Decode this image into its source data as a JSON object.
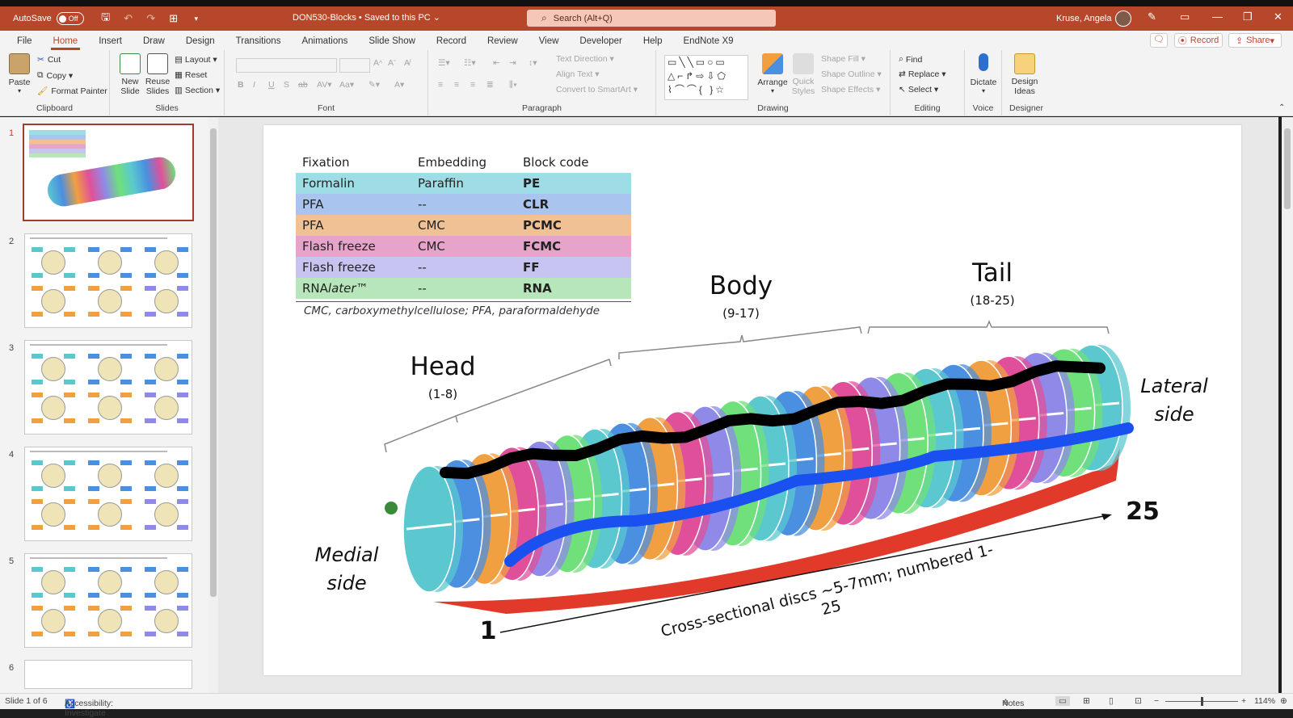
{
  "titlebar": {
    "autosave_label": "AutoSave",
    "autosave_state": "Off",
    "doc_title": "DON530-Blocks • Saved to this PC ⌄",
    "search_placeholder": "Search (Alt+Q)",
    "user_name": "Kruse, Angela"
  },
  "menu": {
    "tabs": [
      "File",
      "Home",
      "Insert",
      "Draw",
      "Design",
      "Transitions",
      "Animations",
      "Slide Show",
      "Record",
      "Review",
      "View",
      "Developer",
      "Help",
      "EndNote X9"
    ],
    "active": "Home",
    "record_label": "Record",
    "share_label": "Share"
  },
  "ribbon": {
    "clipboard": {
      "label": "Clipboard",
      "paste": "Paste",
      "cut": "Cut",
      "copy": "Copy",
      "format_painter": "Format Painter"
    },
    "slides": {
      "label": "Slides",
      "new_slide": "New Slide",
      "reuse_slides": "Reuse Slides",
      "layout": "Layout",
      "reset": "Reset",
      "section": "Section"
    },
    "font": {
      "label": "Font"
    },
    "paragraph": {
      "label": "Paragraph",
      "text_direction": "Text Direction",
      "align_text": "Align Text",
      "convert_smartart": "Convert to SmartArt"
    },
    "drawing": {
      "label": "Drawing",
      "arrange": "Arrange",
      "quick_styles": "Quick Styles",
      "shape_fill": "Shape Fill",
      "shape_outline": "Shape Outline",
      "shape_effects": "Shape Effects"
    },
    "editing": {
      "label": "Editing",
      "find": "Find",
      "replace": "Replace",
      "select": "Select"
    },
    "voice": {
      "label": "Voice",
      "dictate": "Dictate"
    },
    "designer": {
      "label": "Designer",
      "design_ideas": "Design Ideas"
    }
  },
  "thumbnails": [
    "1",
    "2",
    "3",
    "4",
    "5",
    "6"
  ],
  "slide": {
    "table": {
      "headers": [
        "Fixation",
        "Embedding",
        "Block code"
      ],
      "rows": [
        {
          "fixation": "Formalin",
          "embedding": "Paraffin",
          "code": "PE",
          "color": "#9fdde6"
        },
        {
          "fixation": "PFA",
          "embedding": "--",
          "code": "CLR",
          "color": "#a9c4ee"
        },
        {
          "fixation": "PFA",
          "embedding": "CMC",
          "code": "PCMC",
          "color": "#f1c196"
        },
        {
          "fixation": "Flash freeze",
          "embedding": "CMC",
          "code": "FCMC",
          "color": "#e6a4cb"
        },
        {
          "fixation": "Flash freeze",
          "embedding": "--",
          "code": "FF",
          "color": "#c7c4f2"
        },
        {
          "fixation": "RNAlater™",
          "embedding": "--",
          "code": "RNA",
          "color": "#b6e6b9"
        }
      ],
      "note": "CMC, carboxymethylcellulose; PFA, paraformaldehyde"
    },
    "head_label": "Head",
    "head_range": "(1-8)",
    "body_label": "Body",
    "body_range": "(9-17)",
    "tail_label": "Tail",
    "tail_range": "(18-25)",
    "lateral_l1": "Lateral",
    "lateral_l2": "side",
    "medial_l1": "Medial",
    "medial_l2": "side",
    "start_num": "1",
    "end_num": "25",
    "axis_label": "Cross-sectional discs ~5-7mm; numbered 1-25",
    "disc_colors": [
      "#5bc8d0",
      "#4a8fe0",
      "#f0a040",
      "#e0509a",
      "#8f8ae8",
      "#6fe07a"
    ]
  },
  "status": {
    "slide_info": "Slide 1 of 6",
    "accessibility": "Accessibility: Investigate",
    "notes": "Notes",
    "zoom": "114%"
  }
}
